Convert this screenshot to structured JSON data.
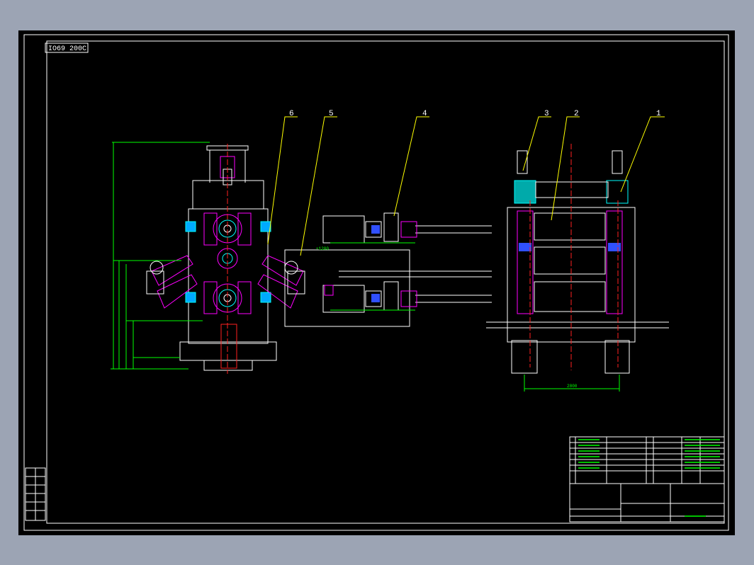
{
  "drawing": {
    "code": "IO69 200C",
    "balloons": [
      "1",
      "2",
      "3",
      "4",
      "5",
      "6"
    ],
    "dim_texts": [
      "2800",
      "+1200"
    ]
  },
  "colors": {
    "background": "#000000",
    "border": "#ffffff",
    "leader": "#ffff00",
    "magenta": "#ff00ff",
    "cyan": "#00ffff",
    "green": "#00ff00",
    "red": "#ff2020",
    "blue": "#3050ff"
  }
}
